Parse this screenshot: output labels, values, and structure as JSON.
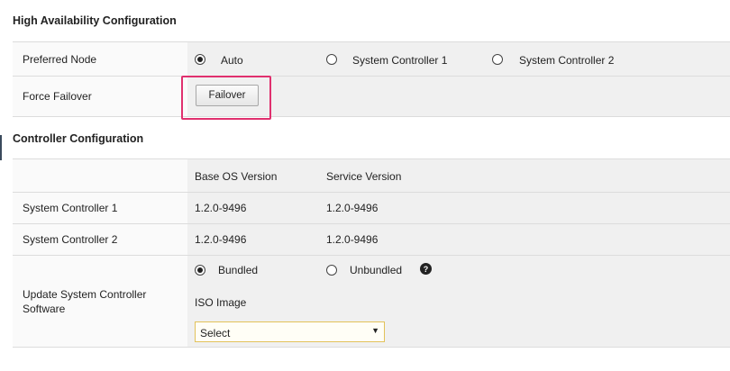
{
  "ha": {
    "title": "High Availability Configuration",
    "preferred_node": {
      "label": "Preferred Node",
      "options": [
        "Auto",
        "System Controller 1",
        "System Controller 2"
      ],
      "selected": "Auto"
    },
    "force_failover": {
      "label": "Force Failover",
      "button": "Failover"
    }
  },
  "controller": {
    "title": "Controller Configuration",
    "headers": [
      "Base OS Version",
      "Service Version"
    ],
    "rows": [
      {
        "name": "System Controller 1",
        "base_os": "1.2.0-9496",
        "service": "1.2.0-9496"
      },
      {
        "name": "System Controller 2",
        "base_os": "1.2.0-9496",
        "service": "1.2.0-9496"
      }
    ],
    "update": {
      "label_line1": "Update System Controller",
      "label_line2": "Software",
      "options": [
        "Bundled",
        "Unbundled"
      ],
      "selected": "Bundled",
      "help": "?",
      "iso_label": "ISO Image",
      "iso_select": "Select",
      "caret": "▼"
    }
  },
  "colors": {
    "highlight": "#e0306e",
    "select_border": "#e2c25a"
  }
}
